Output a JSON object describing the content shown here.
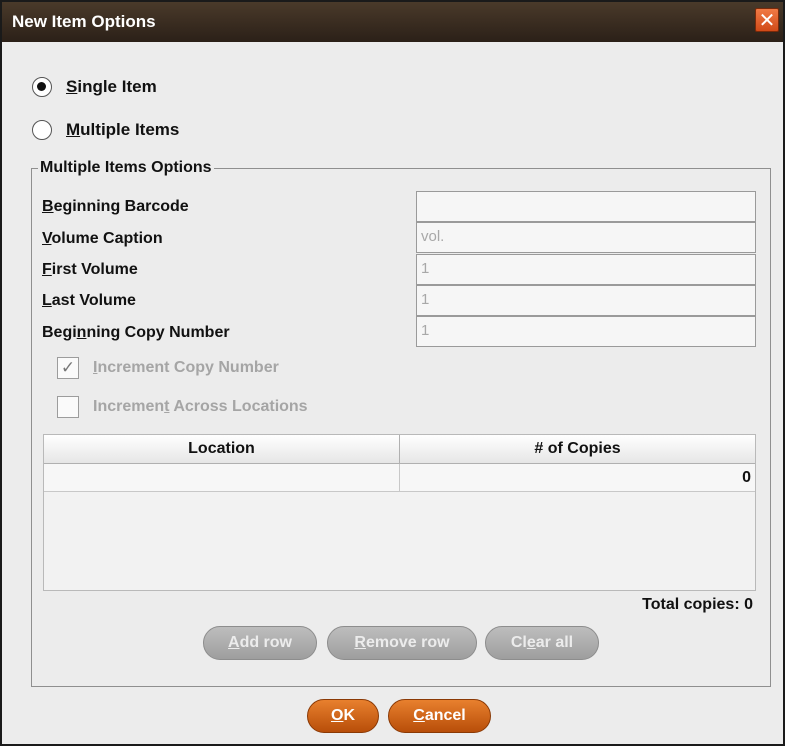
{
  "window": {
    "title": "New Item Options",
    "close_glyph": "✕"
  },
  "mode": {
    "single_prefix": "S",
    "single_rest": "ingle Item",
    "single_checked": true,
    "multiple_prefix": "M",
    "multiple_rest": "ultiple Items",
    "multiple_checked": false
  },
  "options": {
    "group_title": "Multiple Items Options",
    "fields": [
      {
        "label_pre": "",
        "label_key": "B",
        "label_post": "eginning Barcode",
        "value": ""
      },
      {
        "label_pre": "",
        "label_key": "V",
        "label_post": "olume Caption",
        "value": "vol."
      },
      {
        "label_pre": "",
        "label_key": "F",
        "label_post": "irst Volume",
        "value": "1"
      },
      {
        "label_pre": "",
        "label_key": "L",
        "label_post": "ast Volume",
        "value": "1"
      },
      {
        "label_pre": "Begi",
        "label_key": "n",
        "label_post": "ning Copy Number",
        "value": "1"
      }
    ],
    "increment_copy": {
      "pre": "",
      "key": "I",
      "post": "ncrement Copy Number",
      "checked": true,
      "check_glyph": "✓"
    },
    "increment_locations": {
      "pre": "Incremen",
      "key": "t",
      "post": " Across Locations",
      "checked": false
    }
  },
  "table": {
    "columns": [
      "Location",
      "# of Copies"
    ],
    "rows": [
      {
        "location": "",
        "copies": "0"
      }
    ],
    "total": "Total copies: 0"
  },
  "table_buttons": {
    "add_key": "A",
    "add_rest": "dd row",
    "remove_key": "R",
    "remove_rest": "emove row",
    "clear_pre": "Cl",
    "clear_key": "e",
    "clear_rest": "ar all"
  },
  "footer": {
    "ok_key": "O",
    "ok_rest": "K",
    "cancel_key": "C",
    "cancel_rest": "ancel"
  },
  "colors": {
    "title_bar": "#2b2018",
    "accent": "#d0621a",
    "close": "#e0582a"
  }
}
